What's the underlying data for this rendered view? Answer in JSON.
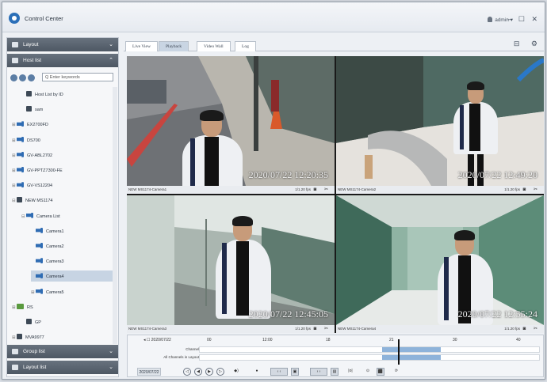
{
  "app": {
    "title": "Control Center",
    "user": "admin",
    "user_caret": "▾",
    "window_controls": "– ☐ ✕"
  },
  "sidebar": {
    "layout_panel": {
      "label": "Layout",
      "arrow": "⌄"
    },
    "host_panel": {
      "label": "Host list",
      "arrow": "⌃"
    },
    "search_placeholder": "Q Enter keywords",
    "tree": [
      {
        "label": "Host List by ID",
        "level": 1,
        "icon": "device-icon",
        "toggle": ""
      },
      {
        "label": "sam",
        "level": 1,
        "icon": "device-icon",
        "toggle": ""
      },
      {
        "label": "EX2700FD",
        "level": 0,
        "icon": "camera-icon",
        "toggle": "⊞"
      },
      {
        "label": "DS700",
        "level": 0,
        "icon": "camera-icon",
        "toggle": "⊞"
      },
      {
        "label": "GV-ABL2702",
        "level": 0,
        "icon": "camera-icon",
        "toggle": "⊞"
      },
      {
        "label": "GV-PPTZ7300-FE",
        "level": 0,
        "icon": "camera-icon",
        "toggle": "⊞"
      },
      {
        "label": "GV-VS12204",
        "level": 0,
        "icon": "camera-icon",
        "toggle": "⊞"
      },
      {
        "label": "NEW MS1174",
        "level": 0,
        "icon": "device-icon",
        "toggle": "⊟"
      },
      {
        "label": "Camera List",
        "level": 1,
        "icon": "camera-icon",
        "toggle": "⊟"
      },
      {
        "label": "Camera1",
        "level": 2,
        "icon": "camera-icon",
        "toggle": ""
      },
      {
        "label": "Camera2",
        "level": 2,
        "icon": "camera-icon",
        "toggle": ""
      },
      {
        "label": "Camera3",
        "level": 2,
        "icon": "camera-icon",
        "toggle": ""
      },
      {
        "label": "Camera4",
        "level": 2,
        "icon": "camera-icon",
        "toggle": "",
        "selected": true
      },
      {
        "label": "Camera5",
        "level": 2,
        "icon": "camera-icon",
        "toggle": "⊞"
      },
      {
        "label": "RS",
        "level": 0,
        "icon": "recorder-icon",
        "toggle": "⊞"
      },
      {
        "label": "GP",
        "level": 1,
        "icon": "device-icon",
        "toggle": ""
      },
      {
        "label": "MVA9977",
        "level": 0,
        "icon": "nvr-icon",
        "toggle": "⊞"
      }
    ],
    "group_panel": {
      "label": "Group list",
      "arrow": "⌄"
    },
    "layout_list_panel": {
      "label": "Layout list",
      "arrow": "⌄"
    }
  },
  "tabs": [
    {
      "label": "Live View"
    },
    {
      "label": "Playback",
      "active": true
    },
    {
      "label": "Video Wall"
    },
    {
      "label": "Log"
    }
  ],
  "tab_tools": "⊟ ⚙",
  "cells": [
    {
      "name": "NEW MS1174-Camera1",
      "rate": "1/1.20 fps",
      "timestamp": "2020/07/22 12:20:35",
      "icons": "◙ ✂"
    },
    {
      "name": "NEW MS1174-Camera2",
      "rate": "1/1.20 fps",
      "timestamp": "2020/07/22 12:49:20",
      "icons": "◙ ✂"
    },
    {
      "name": "NEW MS1174-Camera3",
      "rate": "1/1.20 fps",
      "timestamp": "2020/07/22 12:45:05",
      "icons": "◙ ✂"
    },
    {
      "name": "NEW MS1174-Camera4",
      "rate": "1/1.20 fps",
      "timestamp": "2020/07/22 12:55:24",
      "icons": "◙ ✂"
    }
  ],
  "timeline": {
    "date": "◂ ☐  2020/07/22",
    "ticks": [
      "00",
      "12:00",
      "18",
      "21",
      "30",
      "40"
    ],
    "rows": [
      {
        "label": "Channel"
      },
      {
        "label": "All Channels in Layout"
      }
    ],
    "controls": {
      "date_value": "2020/07/22",
      "buttons": [
        "◁",
        "◀",
        "▶",
        "▷",
        "◆)",
        "●"
      ],
      "squares": [
        "‹ ‹",
        "▣",
        "› ›",
        "▤",
        "|o|",
        "⊙",
        "⬛",
        "⟳"
      ]
    }
  },
  "colors": {
    "accent": "#2b6fb8",
    "panel_head": "#58626e",
    "selected_row": "#c7d4e3",
    "timeline_segment": "#8eb3da"
  }
}
